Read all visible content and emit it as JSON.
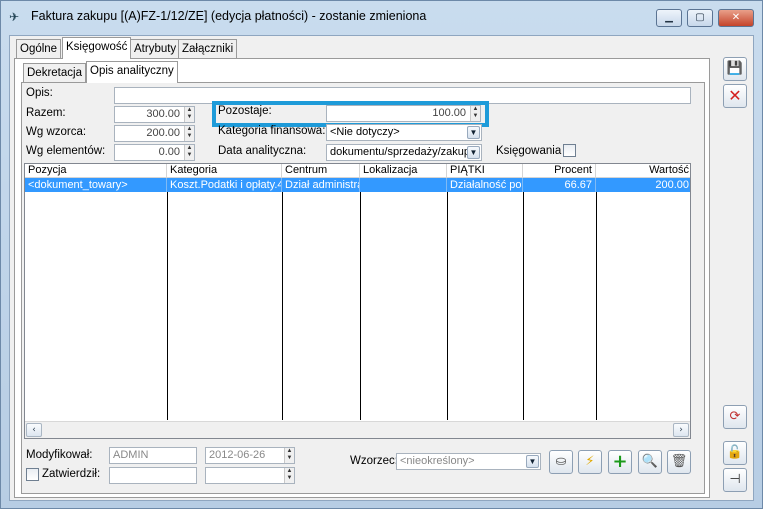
{
  "window": {
    "title": "Faktura zakupu [(A)FZ-1/12/ZE] (edycja płatności) - zostanie zmieniona",
    "min_label": "▭",
    "max_label": "▢",
    "close_label": "✕"
  },
  "tabs": [
    "Ogólne",
    "Księgowość",
    "Atrybuty",
    "Załączniki"
  ],
  "subtabs": [
    "Dekretacja",
    "Opis analityczny"
  ],
  "form": {
    "opis_label": "Opis:",
    "opis_value": "",
    "razem_label": "Razem:",
    "razem_value": "300.00",
    "wg_wzorca_label": "Wg wzorca:",
    "wg_wzorca_value": "200.00",
    "wg_elementow_label": "Wg elementów:",
    "wg_elementow_value": "0.00",
    "pozostaje_label": "Pozostaje:",
    "pozostaje_value": "100.00",
    "kategoria_label": "Kategoria finansowa:",
    "kategoria_value": "<Nie dotyczy>",
    "data_label": "Data analityczna:",
    "data_value": "dokumentu/sprzedaży/zakup",
    "ksiegowania_label": "Księgowania"
  },
  "grid": {
    "headers": [
      "Pozycja",
      "Kategoria",
      "Centrum",
      "Lokalizacja",
      "PIĄTKI",
      "Procent",
      "Wartość"
    ],
    "row": [
      "<dokument_towary>",
      "Koszt.Podatki i opłaty.4",
      "Dział administra",
      "",
      "Działalność po",
      "66.67",
      "200.00"
    ]
  },
  "footer": {
    "modyfikowal_label": "Modyfikował:",
    "modyfikowal_user": "ADMIN",
    "modyfikowal_date": "2012-06-26",
    "zatwierdzil_label": "Zatwierdził:",
    "zatwierdzil_user": "",
    "zatwierdzil_date": "",
    "wzorzec_label": "Wzorzec:",
    "wzorzec_value": "<nieokreślony>"
  },
  "colors": {
    "highlight": "#1e9bd9",
    "selection": "#3399ff"
  }
}
